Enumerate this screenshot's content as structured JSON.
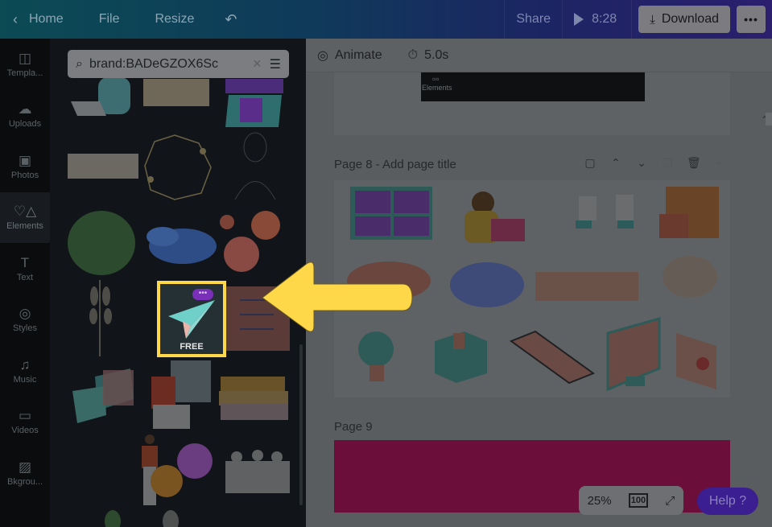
{
  "topbar": {
    "back_label": "Home",
    "file_label": "File",
    "resize_label": "Resize",
    "undo_icon": "undo-icon",
    "share_label": "Share",
    "play_duration": "8:28",
    "download_label": "Download",
    "more_label": "•••"
  },
  "sidenav": {
    "items": [
      {
        "label": "Templa...",
        "icon": "templates-icon"
      },
      {
        "label": "Uploads",
        "icon": "upload-cloud-icon"
      },
      {
        "label": "Photos",
        "icon": "photo-icon"
      },
      {
        "label": "Elements",
        "icon": "elements-shapes-icon",
        "active": true
      },
      {
        "label": "Text",
        "icon": "text-icon"
      },
      {
        "label": "Styles",
        "icon": "palette-icon"
      },
      {
        "label": "Music",
        "icon": "music-note-icon"
      },
      {
        "label": "Videos",
        "icon": "video-icon"
      },
      {
        "label": "Bkgrou...",
        "icon": "background-hatch-icon"
      }
    ]
  },
  "panel": {
    "search": {
      "value": "brand:BADeGZOX6Sc",
      "clear_icon": "×",
      "filter_icon": "filter-sliders-icon"
    },
    "highlighted_element": {
      "badge": "•••",
      "label": "FREE",
      "description": "paper plane"
    },
    "elements": [
      "person at laptop",
      "torn paper",
      "person video call",
      "torn paper strip",
      "floral wreath",
      "line art portrait",
      "monstera leaf",
      "blue watercolor",
      "coral flowers",
      "leaf sprig",
      "paper plane",
      "checklist",
      "chat bubbles",
      "woman reading by window",
      "stacked books",
      "woman with phone",
      "avatar bubbles",
      "team meeting"
    ]
  },
  "canvas": {
    "toolbar": {
      "animate_label": "Animate",
      "duration_label": "5.0s"
    },
    "prev_page_thumb_label": "Elements",
    "page8": {
      "label": "Page 8 - Add page title",
      "elements": [
        "video call grid",
        "woman with laptop",
        "two people chatting",
        "collage people",
        "red brush stroke",
        "blue watercolor splash",
        "orange brush stroke",
        "pastel brush strokes",
        "light bulb",
        "cardboard box",
        "smartphone",
        "computer monitor",
        "envelope notification"
      ]
    },
    "page9": {
      "label": "Page 9",
      "background_color": "#6b0e3a"
    },
    "zoom": {
      "value": "25%",
      "fit_label": "100"
    },
    "help_label": "Help ?"
  },
  "colors": {
    "highlight": "#ffd84a",
    "help_bg": "#3b1e8f",
    "badge_purple": "#7a2fb8"
  }
}
